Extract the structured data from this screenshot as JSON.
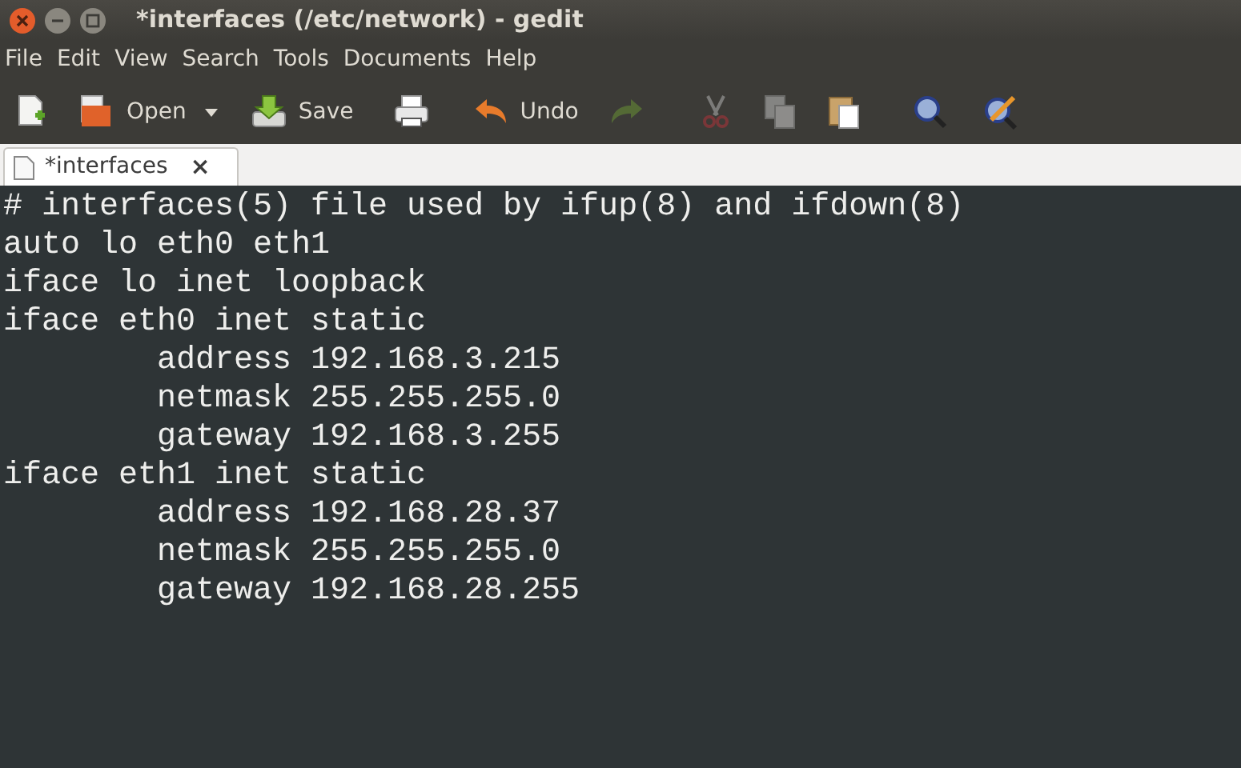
{
  "window": {
    "title": "*interfaces (/etc/network) - gedit"
  },
  "menu": [
    "File",
    "Edit",
    "View",
    "Search",
    "Tools",
    "Documents",
    "Help"
  ],
  "toolbar": [
    {
      "kind": "new",
      "disabled": false
    },
    {
      "kind": "open",
      "label": "Open",
      "disabled": false
    },
    {
      "kind": "dropdown",
      "disabled": false
    },
    {
      "kind": "save",
      "label": "Save",
      "disabled": false
    },
    {
      "kind": "print",
      "disabled": false
    },
    {
      "kind": "undo",
      "label": "Undo",
      "disabled": false
    },
    {
      "kind": "redo",
      "disabled": true
    },
    {
      "kind": "cut",
      "disabled": true
    },
    {
      "kind": "copy",
      "disabled": true
    },
    {
      "kind": "paste",
      "disabled": false
    },
    {
      "kind": "find",
      "disabled": false
    },
    {
      "kind": "replace",
      "disabled": false
    }
  ],
  "tabs": [
    {
      "label": "*interfaces",
      "close": "×"
    }
  ],
  "editor": {
    "lines": [
      "# interfaces(5) file used by ifup(8) and ifdown(8)",
      "auto lo eth0 eth1",
      "iface lo inet loopback",
      "iface eth0 inet static",
      "        address 192.168.3.215",
      "        netmask 255.255.255.0",
      "        gateway 192.168.3.255",
      "iface eth1 inet static",
      "        address 192.168.28.37",
      "        netmask 255.255.255.0",
      "        gateway 192.168.28.255"
    ]
  }
}
